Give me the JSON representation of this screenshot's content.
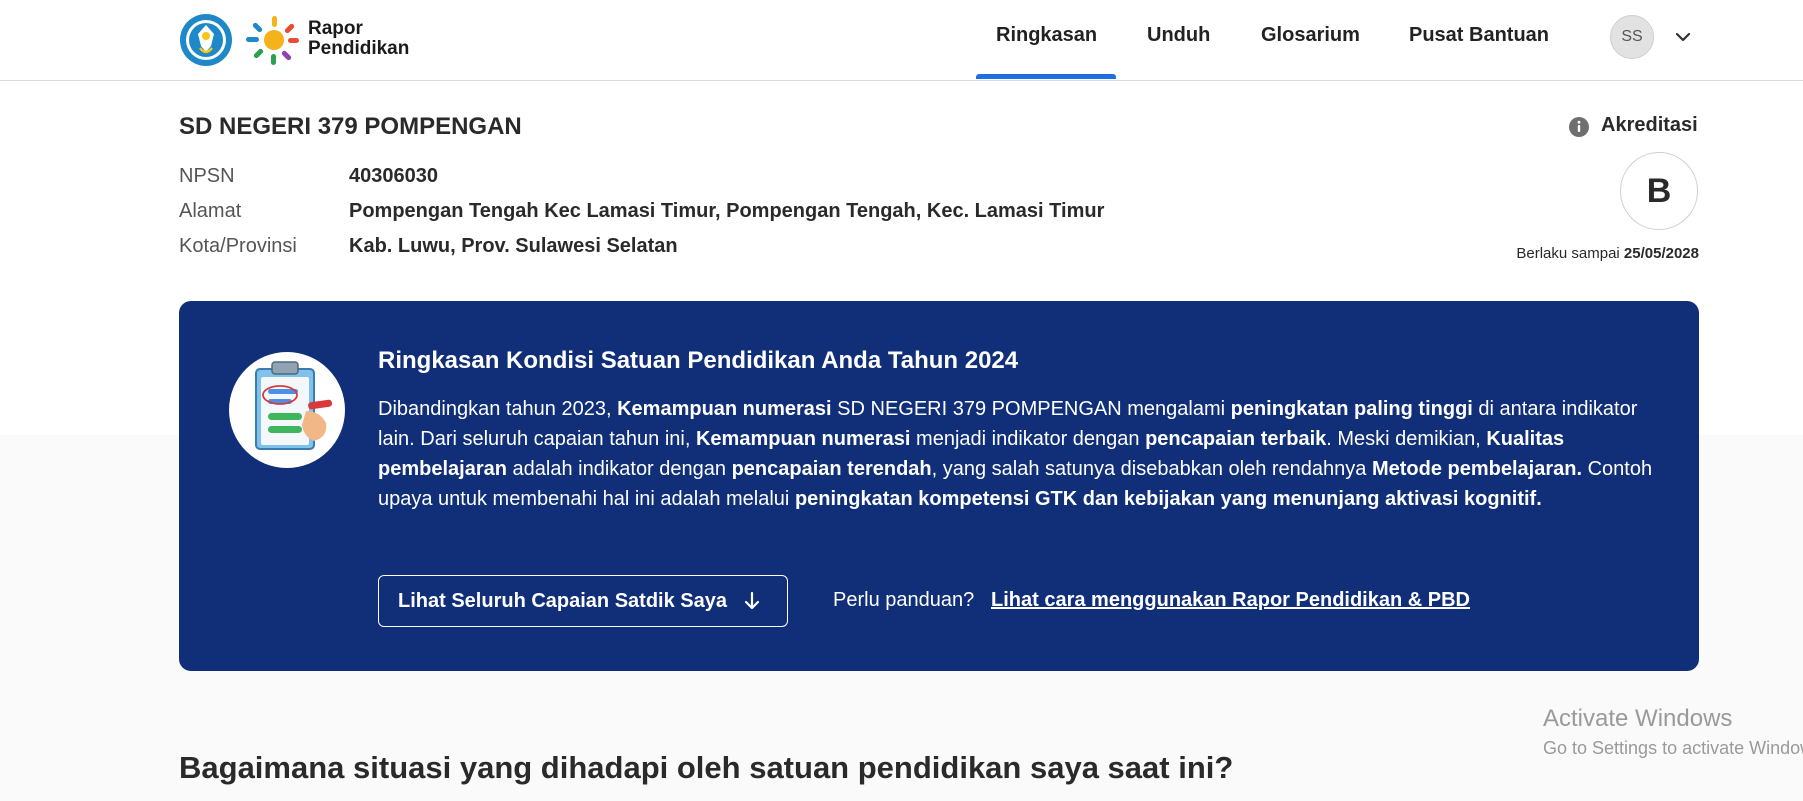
{
  "header": {
    "logo_text_line1": "Rapor",
    "logo_text_line2": "Pendidikan",
    "nav": [
      {
        "label": "Ringkasan",
        "active": true
      },
      {
        "label": "Unduh",
        "active": false
      },
      {
        "label": "Glosarium",
        "active": false
      },
      {
        "label": "Pusat Bantuan",
        "active": false
      }
    ],
    "avatar_initials": "SS",
    "accent_color": "#1f6fe0",
    "icons": [
      "kemdikbud-emblem-icon",
      "sun-logo-icon",
      "chevron-down-icon"
    ]
  },
  "school": {
    "name": "SD NEGERI 379 POMPENGAN",
    "fields": [
      {
        "label": "NPSN",
        "value": "40306030"
      },
      {
        "label": "Alamat",
        "value": "Pompengan Tengah Kec Lamasi Timur, Pompengan Tengah, Kec. Lamasi Timur"
      },
      {
        "label": "Kota/Provinsi",
        "value": "Kab. Luwu, Prov. Sulawesi Selatan"
      }
    ]
  },
  "accreditation": {
    "label": "Akreditasi",
    "grade": "B",
    "valid_prefix": "Berlaku sampai",
    "valid_date": "25/05/2028",
    "icon": "info-icon"
  },
  "summary": {
    "background_color": "#102f78",
    "title": "Ringkasan Kondisi Satuan Pendidikan Anda Tahun 2024",
    "body": [
      {
        "t": "Dibandingkan tahun 2023, ",
        "b": false
      },
      {
        "t": "Kemampuan numerasi",
        "b": true
      },
      {
        "t": " SD NEGERI 379 POMPENGAN mengalami ",
        "b": false
      },
      {
        "t": "peningkatan paling tinggi",
        "b": true
      },
      {
        "t": " di antara indikator lain. Dari seluruh capaian tahun ini, ",
        "b": false
      },
      {
        "t": "Kemampuan numerasi",
        "b": true
      },
      {
        "t": " menjadi indikator dengan ",
        "b": false
      },
      {
        "t": "pencapaian terbaik",
        "b": true
      },
      {
        "t": ". Meski demikian, ",
        "b": false
      },
      {
        "t": "Kualitas pembelajaran",
        "b": true
      },
      {
        "t": " adalah indikator dengan ",
        "b": false
      },
      {
        "t": "pencapaian terendah",
        "b": true
      },
      {
        "t": ", yang salah satunya disebabkan oleh rendahnya ",
        "b": false
      },
      {
        "t": "Metode pembelajaran.",
        "b": true
      },
      {
        "t": " Contoh upaya untuk membenahi hal ini adalah melalui ",
        "b": false
      },
      {
        "t": "peningkatan kompetensi GTK dan kebijakan yang menunjang aktivasi kognitif.",
        "b": true
      }
    ],
    "button_label": "Lihat Seluruh Capaian Satdik Saya",
    "button_icon": "arrow-down-icon",
    "guide_question": "Perlu panduan?",
    "guide_link": "Lihat cara menggunakan Rapor Pendidikan & PBD",
    "illustration": "clipboard-checklist-illustration"
  },
  "section_heading": "Bagaimana situasi yang dihadapi oleh satuan pendidikan saya saat ini?",
  "watermark": {
    "title": "Activate Windows",
    "subtitle": "Go to Settings to activate Windows."
  }
}
